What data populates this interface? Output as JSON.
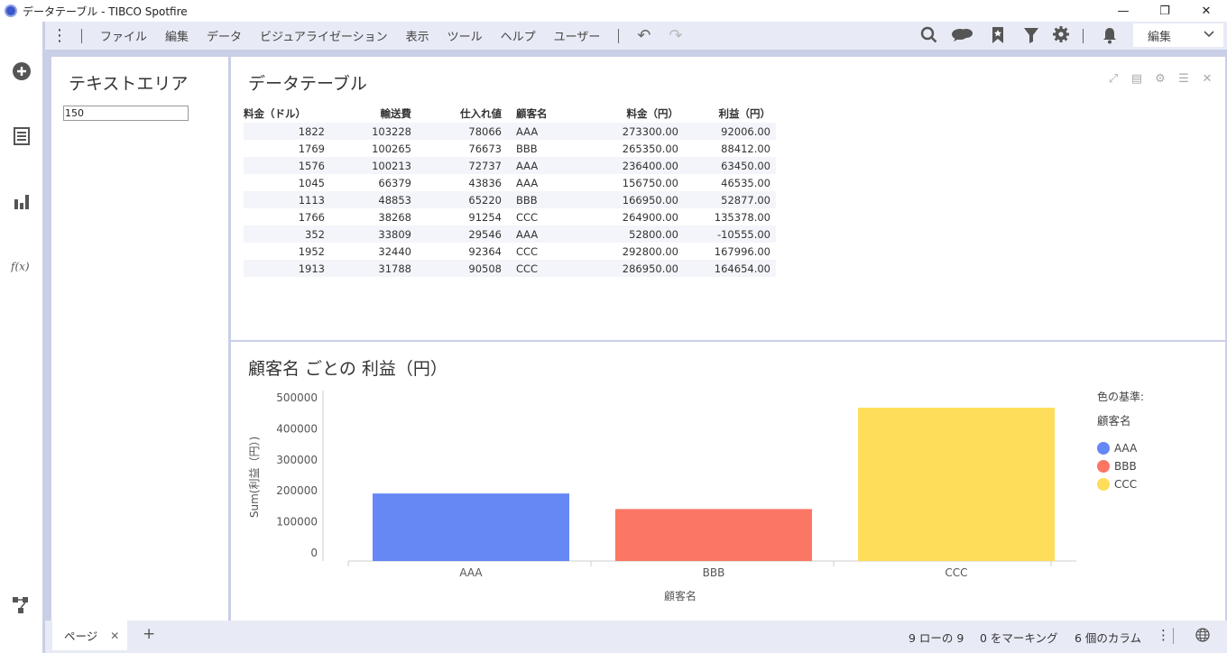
{
  "window": {
    "title": "データテーブル - TIBCO Spotfire",
    "minimize": "—",
    "restore": "❐",
    "close": "✕"
  },
  "menu": {
    "more": "⋮",
    "items": [
      "ファイル",
      "編集",
      "データ",
      "ビジュアライゼーション",
      "表示",
      "ツール",
      "ヘルプ",
      "ユーザー"
    ],
    "undo": "↶",
    "redo": "↷",
    "mode_label": "編集"
  },
  "icons": {
    "search": "search-icon",
    "chat": "chat-icon",
    "bookmark": "bookmark-icon",
    "filter": "filter-icon",
    "settings": "gear-icon",
    "notification": "bell-icon"
  },
  "text_area": {
    "title": "テキストエリア",
    "input_value": "150"
  },
  "table": {
    "title": "データテーブル",
    "columns": [
      "料金（ドル）",
      "輸送費",
      "仕入れ値",
      "顧客名",
      "料金（円）",
      "利益（円）"
    ],
    "rows": [
      [
        "1822",
        "103228",
        "78066",
        "AAA",
        "273300.00",
        "92006.00"
      ],
      [
        "1769",
        "100265",
        "76673",
        "BBB",
        "265350.00",
        "88412.00"
      ],
      [
        "1576",
        "100213",
        "72737",
        "AAA",
        "236400.00",
        "63450.00"
      ],
      [
        "1045",
        "66379",
        "43836",
        "AAA",
        "156750.00",
        "46535.00"
      ],
      [
        "1113",
        "48853",
        "65220",
        "BBB",
        "166950.00",
        "52877.00"
      ],
      [
        "1766",
        "38268",
        "91254",
        "CCC",
        "264900.00",
        "135378.00"
      ],
      [
        "352",
        "33809",
        "29546",
        "AAA",
        "52800.00",
        "-10555.00"
      ],
      [
        "1952",
        "32440",
        "92364",
        "CCC",
        "292800.00",
        "167996.00"
      ],
      [
        "1913",
        "31788",
        "90508",
        "CCC",
        "286950.00",
        "164654.00"
      ]
    ]
  },
  "chart_data": {
    "type": "bar",
    "title": "顧客名 ごとの 利益（円）",
    "categories": [
      "AAA",
      "BBB",
      "CCC"
    ],
    "values": [
      191436,
      141289,
      468028
    ],
    "colors": [
      "#6688f5",
      "#fb7664",
      "#fedd5a"
    ],
    "xlabel": "顧客名",
    "ylabel": "Sum(利益（円）)",
    "ylim": [
      0,
      500000
    ],
    "yticks": [
      0,
      100000,
      200000,
      300000,
      400000,
      500000
    ],
    "ytick_labels": [
      "0",
      "100000",
      "200000",
      "300000",
      "400000",
      "500000"
    ],
    "legend": {
      "title": "色の基準:",
      "subtitle": "顧客名",
      "position": "right"
    }
  },
  "status": {
    "page_tab": "ページ",
    "add_page": "+",
    "rows_info": "9 ローの 9",
    "marking_info": "0 をマーキング",
    "columns_info": "6 個のカラム",
    "more": "⋮"
  }
}
